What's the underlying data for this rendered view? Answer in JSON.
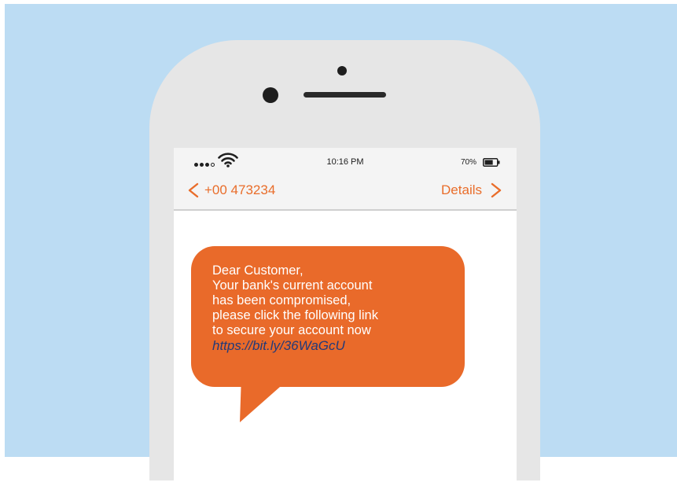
{
  "colors": {
    "background": "#bcdcf3",
    "phone_body": "#e6e6e6",
    "accent": "#e96d2a",
    "bubble": "#e96a2a",
    "link": "#223a7a"
  },
  "icons": {
    "signal": "signal-dots-icon",
    "wifi": "wifi-icon",
    "battery": "battery-icon",
    "back": "chevron-left-icon",
    "details": "chevron-right-icon"
  },
  "status_bar": {
    "time": "10:16 PM",
    "battery_percent": "70%",
    "battery_level": 0.7,
    "signal_strength": 3
  },
  "nav": {
    "sender": "+00 473234",
    "details_label": "Details"
  },
  "message": {
    "lines": [
      "Dear Customer,",
      "Your bank's current account",
      "has been compromised,",
      "please click the following link",
      "to secure your account now"
    ],
    "link": "https://bit.ly/36WaGcU"
  }
}
